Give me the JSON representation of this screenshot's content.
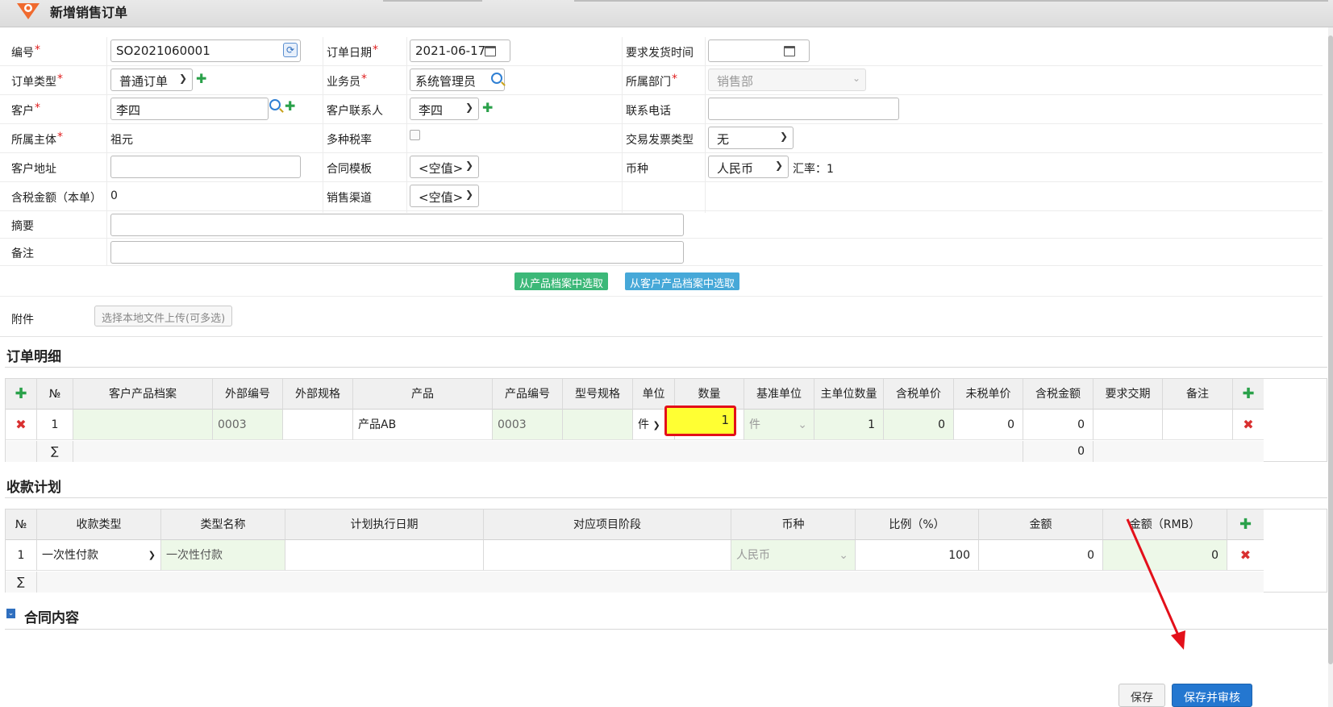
{
  "title": "新增销售订单",
  "form": {
    "code": {
      "label": "编号",
      "value": "SO2021060001"
    },
    "order_date": {
      "label": "订单日期",
      "value": "2021-06-17"
    },
    "ship_time": {
      "label": "要求发货时间",
      "value": ""
    },
    "order_type": {
      "label": "订单类型",
      "value": "普通订单"
    },
    "salesman": {
      "label": "业务员",
      "value": "系统管理员"
    },
    "department": {
      "label": "所属部门",
      "value": "销售部"
    },
    "customer": {
      "label": "客户",
      "value": "李四"
    },
    "contact": {
      "label": "客户联系人",
      "value": "李四"
    },
    "phone": {
      "label": "联系电话",
      "value": ""
    },
    "entity": {
      "label": "所属主体",
      "value": "祖元"
    },
    "multi_tax": {
      "label": "多种税率"
    },
    "invoice_type": {
      "label": "交易发票类型",
      "value": "无"
    },
    "address": {
      "label": "客户地址",
      "value": ""
    },
    "contract_tpl": {
      "label": "合同模板",
      "value": "<空值>"
    },
    "currency": {
      "label": "币种",
      "value": "人民币",
      "rate_text": "汇率：1"
    },
    "amount": {
      "label": "含税金额（本单）",
      "value": "0"
    },
    "channel": {
      "label": "销售渠道",
      "value": "<空值>"
    },
    "summary": {
      "label": "摘要",
      "value": ""
    },
    "remark": {
      "label": "备注",
      "value": ""
    },
    "btn_from_product": "从产品档案中选取",
    "btn_from_customer_product": "从客户产品档案中选取",
    "attachment": {
      "label": "附件",
      "button": "选择本地文件上传(可多选)"
    }
  },
  "order_detail": {
    "title": "订单明细",
    "headers": [
      "№",
      "客户产品档案",
      "外部编号",
      "外部规格",
      "产品",
      "产品编号",
      "型号规格",
      "单位",
      "数量",
      "基准单位",
      "主单位数量",
      "含税单价",
      "未税单价",
      "含税金额",
      "要求交期",
      "备注"
    ],
    "row": {
      "no": "1",
      "ext_code": "0003",
      "product": "产品AB",
      "product_code": "0003",
      "unit": "件",
      "qty": "1",
      "base_unit": "件",
      "main_qty": "1",
      "tax_price": "0",
      "notax_price": "0",
      "tax_amount": "0"
    },
    "sum_symbol": "∑",
    "sum_amount": "0"
  },
  "payment_plan": {
    "title": "收款计划",
    "headers": [
      "№",
      "收款类型",
      "类型名称",
      "计划执行日期",
      "对应项目阶段",
      "币种",
      "比例（%）",
      "金额",
      "金额（RMB）"
    ],
    "row": {
      "no": "1",
      "type": "一次性付款",
      "type_name": "一次性付款",
      "currency": "人民币",
      "ratio": "100",
      "amount": "0",
      "amount_rmb": "0"
    },
    "sum_symbol": "∑"
  },
  "contract": {
    "title": "合同内容"
  },
  "footer": {
    "save": "保存",
    "save_audit": "保存并审核"
  },
  "colors": {
    "accent": "#2477d0",
    "green_btn": "#3cb878",
    "blue_btn": "#46a8d8",
    "highlight": "#ffff33",
    "annotation": "#e3101a"
  }
}
